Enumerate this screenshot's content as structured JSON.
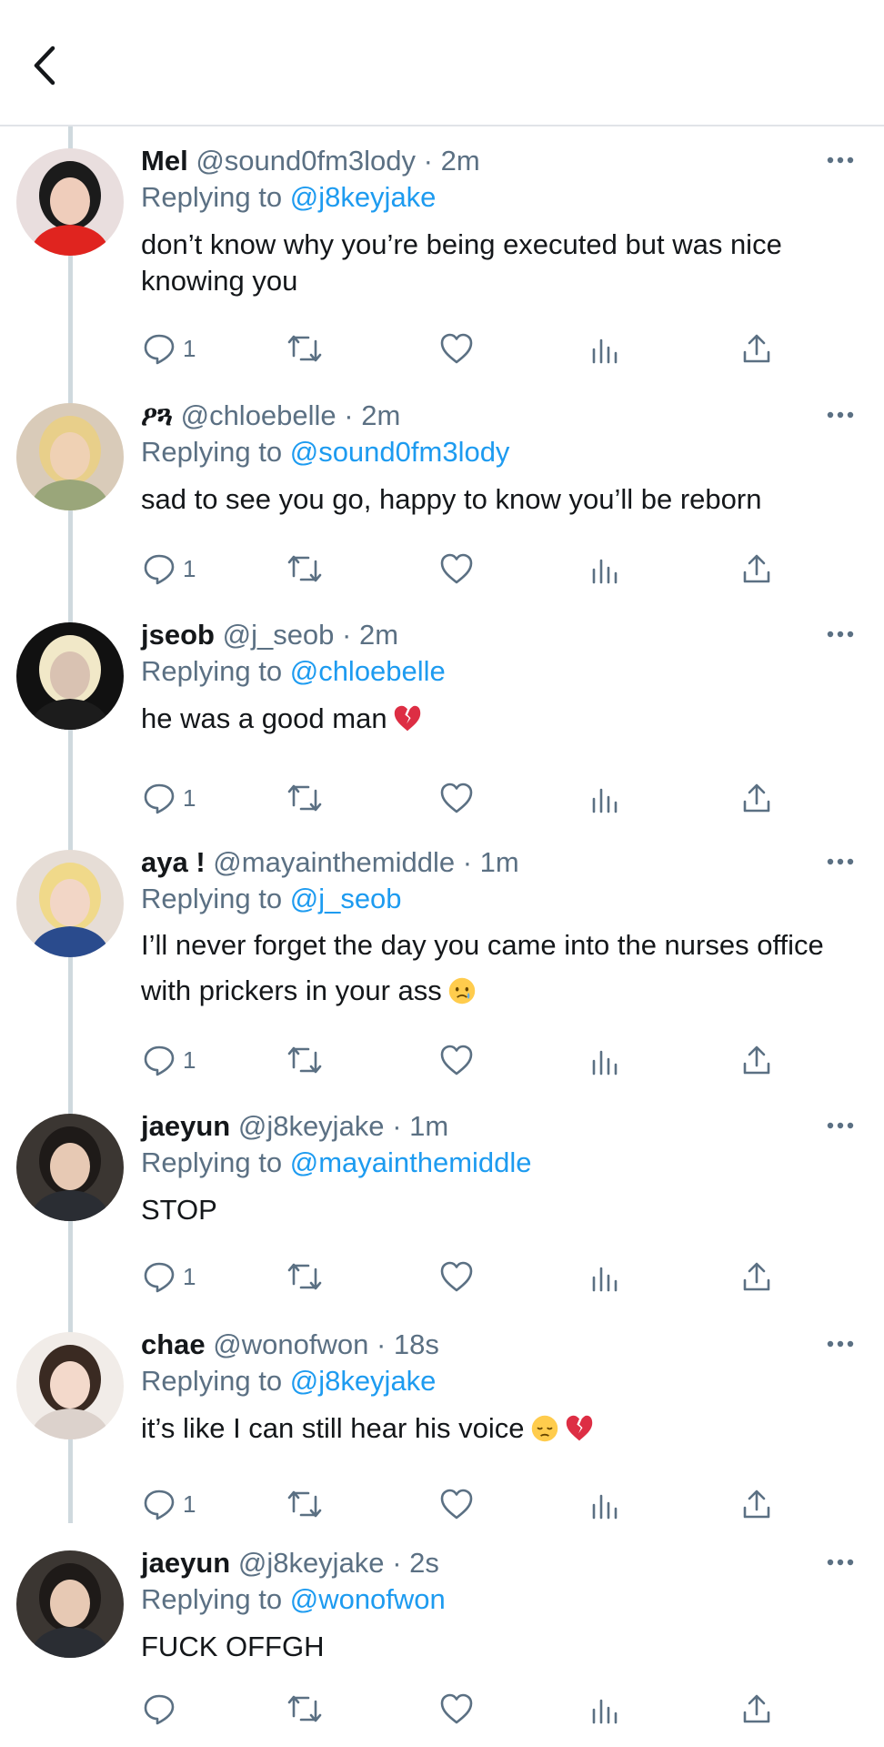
{
  "header": {
    "back_icon": "chevron-left-icon"
  },
  "colors": {
    "link": "#1d9bf0",
    "muted": "#5b7083",
    "text": "#14171a",
    "line": "#cfd9de",
    "heart": "#e0245e"
  },
  "tweets": [
    {
      "name": "Mel",
      "handle": "@sound0fm3lody",
      "time": "· 2m",
      "replying_label": "Replying to",
      "replying_to": "@j8keyjake",
      "text": "don’t know why you’re being executed but was nice knowing you",
      "emoji": [],
      "reply_count": "1"
    },
    {
      "name": "ዖጓ",
      "handle": "@chloebelle",
      "time": "· 2m",
      "replying_label": "Replying to",
      "replying_to": "@sound0fm3lody",
      "text": "sad to see you go, happy to know you’ll be reborn",
      "emoji": [],
      "reply_count": "1"
    },
    {
      "name": "jseob",
      "handle": "@j_seob",
      "time": "· 2m",
      "replying_label": "Replying to",
      "replying_to": "@chloebelle",
      "text": "he was a good man",
      "emoji": [
        "broken-heart"
      ],
      "reply_count": "1"
    },
    {
      "name": "aya !",
      "handle": "@mayainthemiddle",
      "time": "· 1m",
      "replying_label": "Replying to",
      "replying_to": "@j_seob",
      "text": "I’ll never forget the day you came into the nurses office with prickers in your ass",
      "emoji": [
        "crying-face"
      ],
      "reply_count": "1"
    },
    {
      "name": "jaeyun",
      "handle": "@j8keyjake",
      "time": "· 1m",
      "replying_label": "Replying to",
      "replying_to": "@mayainthemiddle",
      "text": "STOP",
      "emoji": [],
      "reply_count": "1"
    },
    {
      "name": "chae",
      "handle": "@wonofwon",
      "time": "· 18s",
      "replying_label": "Replying to",
      "replying_to": "@j8keyjake",
      "text": "it’s like I can still hear his voice",
      "emoji": [
        "pensive-face",
        "broken-heart"
      ],
      "reply_count": "1"
    },
    {
      "name": "jaeyun",
      "handle": "@j8keyjake",
      "time": "· 2s",
      "replying_label": "Replying to",
      "replying_to": "@wonofwon",
      "text": "FUCK OFFGH",
      "emoji": [],
      "reply_count": ""
    }
  ]
}
